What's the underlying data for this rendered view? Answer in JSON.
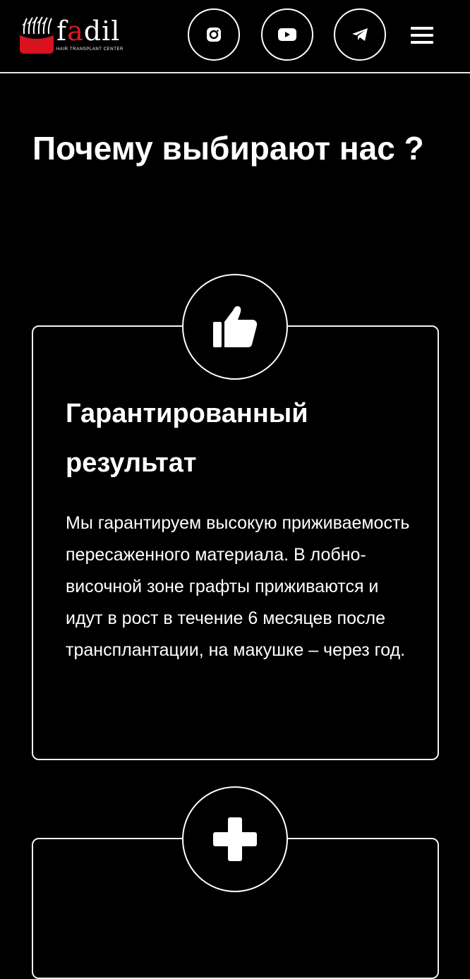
{
  "header": {
    "logo": {
      "name_prefix": "f",
      "name_accent": "a",
      "name_suffix": "dil",
      "tagline": "HAIR TRANSPLANT CENTER",
      "brand_color": "#d9121f"
    },
    "social": [
      {
        "name": "instagram",
        "icon": "instagram-icon"
      },
      {
        "name": "youtube",
        "icon": "youtube-icon"
      },
      {
        "name": "telegram",
        "icon": "telegram-icon"
      }
    ],
    "menu_icon": "hamburger-menu-icon"
  },
  "section": {
    "title": "Почему выбирают нас ?"
  },
  "cards": [
    {
      "icon": "thumbs-up-icon",
      "title": "Гарантированный результат",
      "text": "Мы гарантируем высокую приживаемость пересаженного материала. В лобно-височной зоне графты приживаются и идут в рост в течение 6 месяцев после трансплантации, на макушке – через год."
    },
    {
      "icon": "plus-icon"
    }
  ],
  "colors": {
    "background": "#000000",
    "text": "#ffffff",
    "border": "#f2f2f2",
    "accent": "#d9121f"
  }
}
